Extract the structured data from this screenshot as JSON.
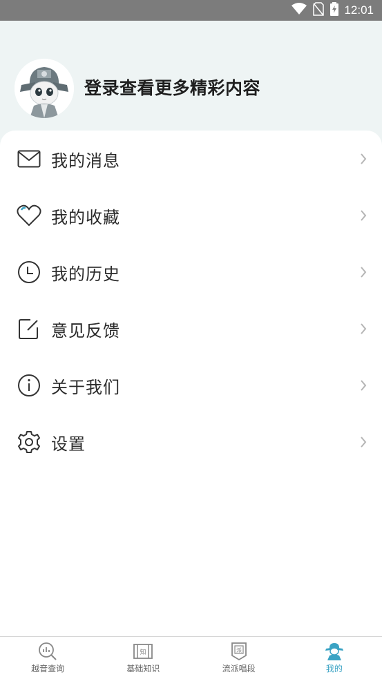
{
  "status_bar": {
    "time": "12:01",
    "icons": [
      "wifi-icon",
      "no-sim-icon",
      "battery-charging-icon"
    ]
  },
  "header": {
    "login_prompt": "登录查看更多精彩内容",
    "avatar": "opera-character-avatar"
  },
  "menu": {
    "items": [
      {
        "label": "我的消息",
        "icon": "mail-icon"
      },
      {
        "label": "我的收藏",
        "icon": "heart-icon"
      },
      {
        "label": "我的历史",
        "icon": "clock-icon"
      },
      {
        "label": "意见反馈",
        "icon": "edit-icon"
      },
      {
        "label": "关于我们",
        "icon": "info-icon"
      },
      {
        "label": "设置",
        "icon": "gear-icon"
      }
    ]
  },
  "tabbar": {
    "tabs": [
      {
        "label": "越音查询",
        "icon": "search-chart-icon",
        "active": false
      },
      {
        "label": "基础知识",
        "icon": "book-icon",
        "active": false
      },
      {
        "label": "流派唱段",
        "icon": "banner-icon",
        "active": false
      },
      {
        "label": "我的",
        "icon": "profile-icon",
        "active": true
      }
    ]
  },
  "colors": {
    "accent": "#3aa3c4",
    "header_bg": "#eef4f4",
    "status_bar": "#7c7c7c"
  }
}
